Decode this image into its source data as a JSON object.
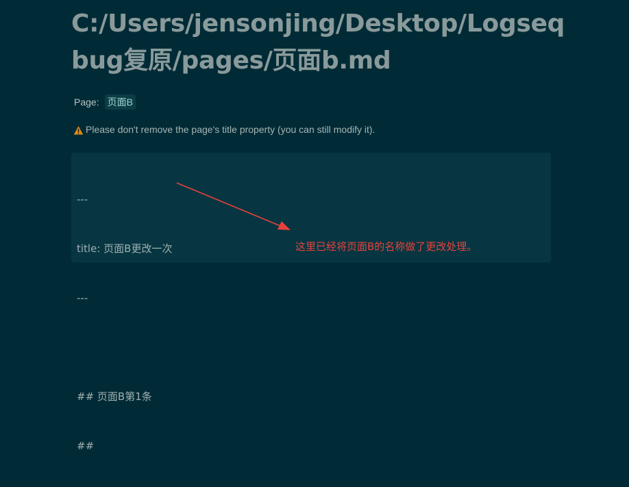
{
  "page": {
    "title": "C:/Users/jensonjing/Desktop/Logseq bug复原/pages/页面b.md"
  },
  "property": {
    "key": "Page:",
    "value": "页面B"
  },
  "warning": {
    "icon": "warning-triangle-icon",
    "text": "Please don't remove the page's title property (you can still modify it)."
  },
  "code": {
    "lines": [
      "---",
      "title: 页面B更改一次",
      "---",
      "",
      "## 页面B第1条",
      "##"
    ]
  },
  "annotation": {
    "text": "这里已经将页面B的名称做了更改处理。",
    "color": "#e8413a"
  },
  "colors": {
    "background": "#002b36",
    "code_background": "#073642",
    "warning_icon": "#d98b18"
  }
}
